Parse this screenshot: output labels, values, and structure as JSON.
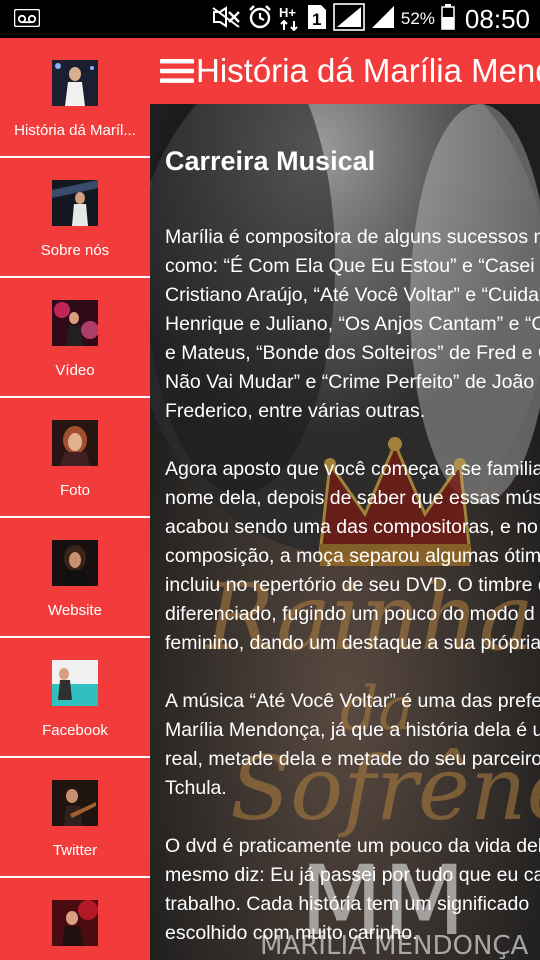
{
  "status_bar": {
    "icons": [
      "voicemail-icon",
      "mute-icon",
      "alarm-icon",
      "hplus-icon",
      "sim1-icon",
      "signal-icon",
      "signal2-icon",
      "battery-icon"
    ],
    "network": "H+",
    "sim_slot": "1",
    "battery": "52%",
    "time": "08:50"
  },
  "toolbar": {
    "title": "História dá Marília Mendonça",
    "menu_icon": "hamburger-icon"
  },
  "sidebar": {
    "items": [
      {
        "label": "História dá Maríl...",
        "thumb": "photo-singer-stage-white"
      },
      {
        "label": "Sobre nós",
        "thumb": "photo-singer-concert"
      },
      {
        "label": "Vídeo",
        "thumb": "photo-singer-red-lights"
      },
      {
        "label": "Foto",
        "thumb": "photo-singer-microphone"
      },
      {
        "label": "Website",
        "thumb": "photo-singer-dark"
      },
      {
        "label": "Facebook",
        "thumb": "photo-singer-teal"
      },
      {
        "label": "Twitter",
        "thumb": "photo-singer-guitar"
      },
      {
        "label": "",
        "thumb": "photo-singer-red"
      }
    ]
  },
  "article": {
    "heading": "Carreira Musical",
    "p1": [
      "Marília é compositora de alguns sucessos n",
      "como: “É Com Ela Que Eu Estou” e “Casei d",
      "Cristiano Araújo, “Até Você Voltar” e “Cuida",
      "Henrique e Juliano, “Os Anjos Cantam” e “C",
      "e Mateus, “Bonde dos Solteiros” de Fred e G",
      "Não Vai Mudar” e “Crime Perfeito” de João",
      "Frederico, entre várias outras."
    ],
    "p2": [
      "Agora aposto que você começa a se familia",
      "nome dela, depois de saber que essas músi",
      "acabou sendo uma das compositoras, e no",
      "composição, a moça separou algumas ótim",
      "incluiu no repertório de seu DVD. O timbre d",
      "diferenciado, fugindo um pouco do modo d",
      "feminino, dando um destaque a sua própria"
    ],
    "p3": [
      "A música “Até Você Voltar” é uma das prefe",
      "Marília Mendonça, já que a história dela é u",
      "real, metade dela e metade do seu parceiro",
      "Tchula."
    ],
    "p4": [
      "O dvd é praticamente um pouco da vida del",
      "mesmo diz: Eu já passei por tudo que eu ca",
      "trabalho. Cada história tem um significado",
      "escolhido com muito carinho."
    ]
  },
  "background": {
    "art_text_1": "Rainha",
    "art_text_2": "da",
    "art_text_3": "Sofrência",
    "logo_text": "MM",
    "logo_sub": "MARÍLIA MENDONÇA"
  },
  "colors": {
    "accent": "#f23c3c",
    "status_bar": "#000000",
    "text": "#ffffff"
  }
}
